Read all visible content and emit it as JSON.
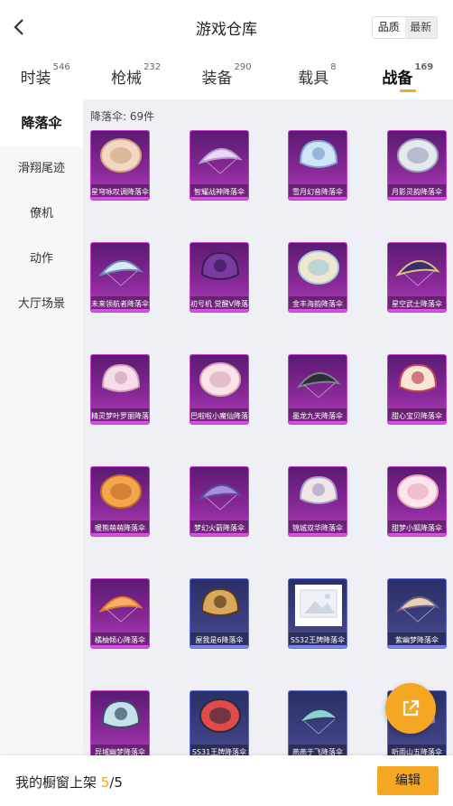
{
  "header": {
    "title": "游戏仓库",
    "sort_options": [
      "品质",
      "最新"
    ]
  },
  "tabs": [
    {
      "label": "时装",
      "count": "546"
    },
    {
      "label": "枪械",
      "count": "232"
    },
    {
      "label": "装备",
      "count": "290"
    },
    {
      "label": "载具",
      "count": "8"
    },
    {
      "label": "战备",
      "count": "169",
      "active": true
    }
  ],
  "sidebar": {
    "items": [
      {
        "label": "降落伞",
        "active": true
      },
      {
        "label": "滑翔尾迹"
      },
      {
        "label": "僚机"
      },
      {
        "label": "动作"
      },
      {
        "label": "大厅场景"
      }
    ]
  },
  "content": {
    "count_label": "降落伞: 69件",
    "items": [
      {
        "name": "星穹咏叹调降落伞",
        "tier": "pink",
        "icon": "parachute-icon"
      },
      {
        "name": "智耀战神降落伞",
        "tier": "pink",
        "icon": "parachute-icon"
      },
      {
        "name": "雪月幻音降落伞",
        "tier": "pink",
        "icon": "parachute-icon"
      },
      {
        "name": "月影灵韵降落伞",
        "tier": "pink",
        "icon": "parachute-icon"
      },
      {
        "name": "未来领航者降落伞",
        "tier": "pink",
        "icon": "parachute-icon"
      },
      {
        "name": "初号机 觉醒V降落伞",
        "tier": "pink",
        "icon": "parachute-icon"
      },
      {
        "name": "金丰海韵降落伞",
        "tier": "pink",
        "icon": "parachute-icon"
      },
      {
        "name": "星空武士降落伞",
        "tier": "pink",
        "icon": "parachute-icon"
      },
      {
        "name": "精灵梦叶罗丽降落伞",
        "tier": "pink",
        "icon": "parachute-icon"
      },
      {
        "name": "巴啦啦小魔仙降落伞",
        "tier": "pink",
        "icon": "parachute-icon"
      },
      {
        "name": "墨龙九天降落伞",
        "tier": "pink",
        "icon": "parachute-icon"
      },
      {
        "name": "甜心宝贝降落伞",
        "tier": "pink",
        "icon": "parachute-icon"
      },
      {
        "name": "暖熊萌萌降落伞",
        "tier": "pink",
        "icon": "parachute-icon"
      },
      {
        "name": "梦幻火箭降落伞",
        "tier": "pink",
        "icon": "parachute-icon"
      },
      {
        "name": "锦城双华降落伞",
        "tier": "pink",
        "icon": "parachute-icon"
      },
      {
        "name": "甜梦小狐降落伞",
        "tier": "pink",
        "icon": "parachute-icon"
      },
      {
        "name": "橘柚倾心降落伞",
        "tier": "pink",
        "icon": "parachute-icon"
      },
      {
        "name": "屋我是6降落伞",
        "tier": "blue",
        "icon": "parachute-icon"
      },
      {
        "name": "SS32王牌降落伞",
        "tier": "blue",
        "icon": "image-placeholder-icon"
      },
      {
        "name": "紫幽梦降落伞",
        "tier": "blue",
        "icon": "parachute-icon"
      },
      {
        "name": "异域幽梦降落伞",
        "tier": "pink",
        "icon": "parachute-icon"
      },
      {
        "name": "SS31王牌降落伞",
        "tier": "blue",
        "icon": "parachute-icon"
      },
      {
        "name": "燕燕于飞降落伞",
        "tier": "blue",
        "icon": "parachute-icon"
      },
      {
        "name": "听雨山五降落伞",
        "tier": "blue",
        "icon": "parachute-icon"
      }
    ]
  },
  "footer": {
    "text": "我的橱窗上架",
    "current": "5",
    "total": "5",
    "edit_label": "编辑"
  },
  "colors": {
    "accent": "#f5a623",
    "pink_tier": "#b53fc4",
    "blue_tier": "#4a4f94"
  }
}
